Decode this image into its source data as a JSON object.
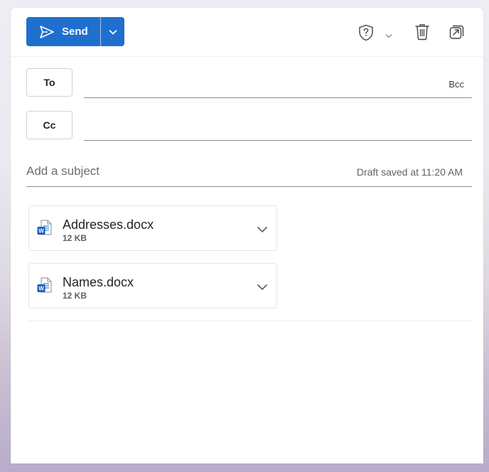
{
  "toolbar": {
    "send_label": "Send",
    "icons": [
      "send-icon",
      "chevron-down-icon",
      "sensitivity-shield-icon",
      "trash-icon",
      "pop-out-icon"
    ]
  },
  "recipients": {
    "to_label": "To",
    "cc_label": "Cc",
    "bcc_label": "Bcc"
  },
  "subject": {
    "placeholder": "Add a subject",
    "value": "",
    "draft_status": "Draft saved at 11:20 AM"
  },
  "attachments": [
    {
      "name": "Addresses.docx",
      "size": "12 KB",
      "icon": "word-doc-icon"
    },
    {
      "name": "Names.docx",
      "size": "12 KB",
      "icon": "word-doc-icon"
    }
  ],
  "colors": {
    "accent": "#1f6fcf",
    "word_blue": "#185abd"
  }
}
